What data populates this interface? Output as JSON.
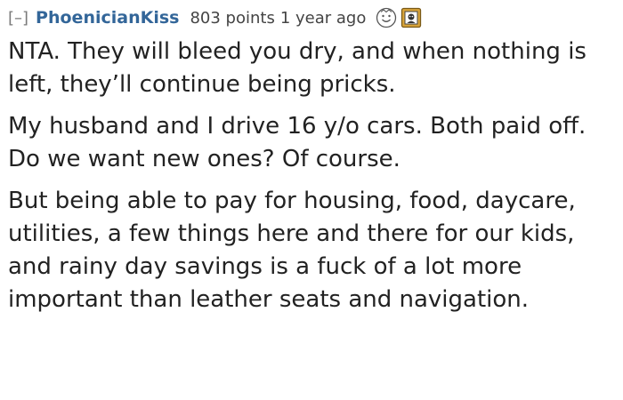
{
  "comment": {
    "collapse_label": "[–]",
    "author": "PhoenicianKiss",
    "score": "803 points",
    "timestamp": "1 year ago",
    "awards": [
      {
        "icon": "happy-cake-award-icon"
      },
      {
        "icon": "framed-portrait-award-icon"
      }
    ],
    "paragraphs": [
      "NTA. They will bleed you dry, and when nothing is left, they’ll continue being pricks.",
      "My husband and I drive 16 y/o cars. Both paid off. Do we want new ones? Of course.",
      "But being able to pay for housing, food, daycare, utilities, a few things here and there for our kids, and rainy day savings is a fuck of a lot more important than leather seats and navigation."
    ]
  },
  "colors": {
    "author": "#336699",
    "meta": "#444444",
    "collapse": "#7a7a7a",
    "text": "#222222"
  }
}
